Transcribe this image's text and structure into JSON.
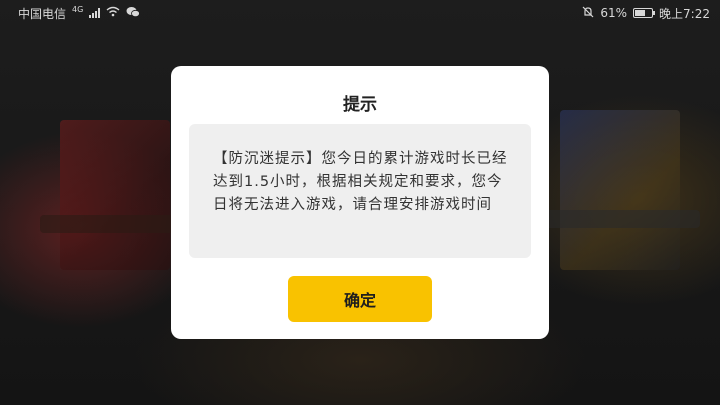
{
  "status_bar": {
    "carrier": "中国电信",
    "network": "4G",
    "battery_percent": "61%",
    "battery_level": 0.61,
    "time": "晚上7:22"
  },
  "dialog": {
    "title": "提示",
    "message": "【防沉迷提示】您今日的累计游戏时长已经达到1.5小时，根据相关规定和要求，您今日将无法进入游戏，请合理安排游戏时间",
    "confirm_label": "确定",
    "confirm_color": "#f9c200"
  }
}
